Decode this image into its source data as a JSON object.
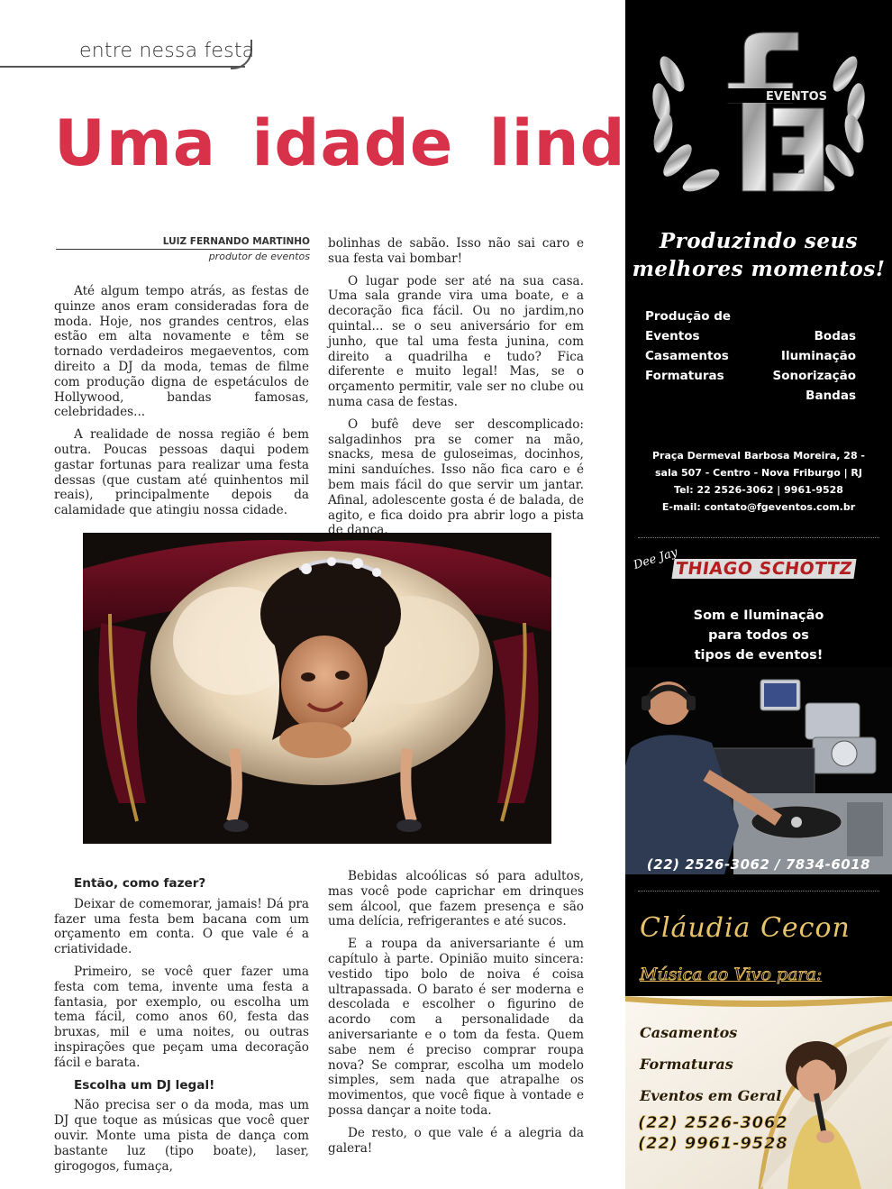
{
  "section": {
    "title": "entre nessa festa"
  },
  "article": {
    "headline": "Uma  idade  linda",
    "author": "LUIZ FERNANDO MARTINHO",
    "author_role": "produtor de eventos",
    "col1": [
      "Até algum tempo atrás, as festas de quinze anos eram consideradas fora de moda. Hoje, nos grandes centros, elas estão em alta novamente e têm se tornado verdadeiros megaeventos, com direito a DJ da moda, temas de filme com produção digna de espetáculos de Hollywood, bandas famosas, celebridades...",
      "A realidade de nossa região é bem outra. Poucas pessoas daqui podem gastar fortunas para realizar uma festa dessas (que custam até quinhentos mil reais), principalmente depois da calamidade que atingiu nossa cidade."
    ],
    "col2": [
      "bolinhas de sabão. Isso não sai caro e sua festa vai bombar!",
      "O lugar pode ser até na sua casa. Uma sala grande vira uma boate, e a decoração fica fácil. Ou no jardim,no quintal... se o seu aniversário for em junho, que tal uma festa junina, com direito a quadrilha e tudo?  Fica diferente e muito legal! Mas, se o orçamento permitir, vale ser no clube ou numa casa de festas.",
      " O bufê deve ser descomplicado: salgadinhos pra se comer na mão, snacks, mesa de guloseimas, docinhos, mini sanduíches. Isso não fica caro e é bem mais fácil do que servir um jantar. Afinal, adolescente gosta é de balada, de agito, e fica doido pra abrir logo a pista de dança."
    ],
    "sub1": "Então, como fazer?",
    "col3a": [
      "Deixar de comemorar, jamais! Dá pra fazer uma festa bem bacana com um orçamento em conta. O que vale é a criatividade.",
      "Primeiro, se você quer  fazer uma festa com tema, invente uma festa a fantasia, por exemplo, ou escolha um tema fácil, como anos 60, festa das bruxas, mil e uma noites, ou outras inspirações que peçam uma decoração fácil e barata."
    ],
    "sub2": "Escolha um DJ legal!",
    "col3b": [
      "Não precisa ser o da moda, mas um DJ que toque as músicas que você quer ouvir. Monte uma pista de dança com bastante luz (tipo boate), laser, girogogos, fumaça,"
    ],
    "col4": [
      "Bebidas alcoólicas só para adultos, mas você pode caprichar em drinques sem álcool, que fazem presença e são uma delícia, refrigerantes e até sucos.",
      "E a roupa da aniversariante é um capítulo à parte. Opinião muito sincera: vestido tipo bolo de noiva é coisa ultrapassada. O barato é ser moderna e descolada e escolher o figurino de acordo com a personalidade da aniversariante e o tom da festa. Quem sabe nem é preciso comprar roupa nova? Se comprar, escolha um modelo simples, sem nada que atrapalhe os movimentos, que você fique à vontade e possa dançar a noite toda.",
      "De resto, o que vale é a alegria da galera!"
    ]
  },
  "ads": {
    "fg": {
      "logo_text": "EVENTOS",
      "tagline_line1": "Produzindo seus",
      "tagline_line2": "melhores momentos!",
      "services_left": [
        "Produção de",
        "Eventos",
        "Casamentos",
        "Formaturas"
      ],
      "services_right": [
        "Bodas",
        "Iluminação",
        "Sonorização",
        "Bandas"
      ],
      "address_line1": "Praça Dermeval Barbosa Moreira, 28 -",
      "address_line2": "sala 507 - Centro - Nova Friburgo | RJ",
      "phone": "Tel: 22 2526-3062 | 9961-9528",
      "email": "E-mail: contato@fgeventos.com.br"
    },
    "dj": {
      "prefix": "Dee Jay",
      "name": "THIAGO SCHOTTZ",
      "line1": "Som e Iluminação",
      "line2": "para todos os",
      "line3": "tipos de eventos!",
      "phones": "(22) 2526-3062 / 7834-6018"
    },
    "claudia": {
      "name": "Cláudia Cecon",
      "subtitle": "Música ao Vivo para:",
      "items": [
        "Casamentos",
        "Formaturas",
        "Eventos em Geral"
      ],
      "phones": [
        "(22) 2526-3062",
        "(22) 9961-9528"
      ]
    }
  },
  "colors": {
    "headline": "#d8324a",
    "gold": "#e8c36b",
    "dj_red": "#b31d1d"
  }
}
